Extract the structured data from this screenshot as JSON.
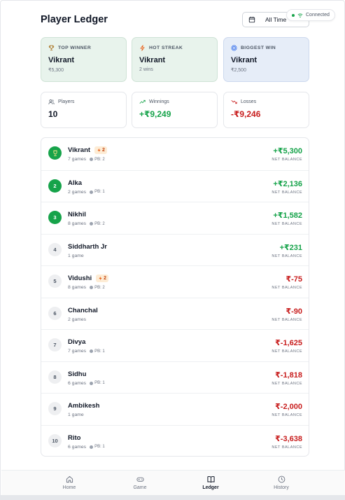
{
  "header": {
    "title": "Player Ledger",
    "range_selected": "All Time",
    "connection_status": "Connected"
  },
  "highlights": [
    {
      "label": "TOP WINNER",
      "icon": "trophy-icon",
      "name": "Vikrant",
      "sub": "₹5,300"
    },
    {
      "label": "HOT STREAK",
      "icon": "bolt-icon",
      "name": "Vikrant",
      "sub": "2 wins"
    },
    {
      "label": "BIGGEST WIN",
      "icon": "target-icon",
      "name": "Vikrant",
      "sub": "₹2,500"
    }
  ],
  "stats": [
    {
      "label": "Players",
      "icon": "users-icon",
      "value": "10"
    },
    {
      "label": "Winnings",
      "icon": "trend-up-icon",
      "value": "+₹9,249"
    },
    {
      "label": "Losses",
      "icon": "trend-down-icon",
      "value": "-₹9,246"
    }
  ],
  "balance_label": "NET BALANCE",
  "players": [
    {
      "rank": "1",
      "name": "Vikrant",
      "games": "7 games",
      "pb": "PB: 2",
      "streak": "2",
      "balance": "+₹5,300",
      "sign": "pos"
    },
    {
      "rank": "2",
      "name": "Alka",
      "games": "2 games",
      "pb": "PB: 1",
      "streak": "",
      "balance": "+₹2,136",
      "sign": "pos"
    },
    {
      "rank": "3",
      "name": "Nikhil",
      "games": "8 games",
      "pb": "PB: 2",
      "streak": "",
      "balance": "+₹1,582",
      "sign": "pos"
    },
    {
      "rank": "4",
      "name": "Siddharth Jr",
      "games": "1 game",
      "pb": "",
      "streak": "",
      "balance": "+₹231",
      "sign": "pos"
    },
    {
      "rank": "5",
      "name": "Vidushi",
      "games": "8 games",
      "pb": "PB: 2",
      "streak": "2",
      "balance": "₹-75",
      "sign": "neg"
    },
    {
      "rank": "6",
      "name": "Chanchal",
      "games": "2 games",
      "pb": "",
      "streak": "",
      "balance": "₹-90",
      "sign": "neg"
    },
    {
      "rank": "7",
      "name": "Divya",
      "games": "7 games",
      "pb": "PB: 1",
      "streak": "",
      "balance": "₹-1,625",
      "sign": "neg"
    },
    {
      "rank": "8",
      "name": "Sidhu",
      "games": "6 games",
      "pb": "PB: 1",
      "streak": "",
      "balance": "₹-1,818",
      "sign": "neg"
    },
    {
      "rank": "9",
      "name": "Ambikesh",
      "games": "1 game",
      "pb": "",
      "streak": "",
      "balance": "₹-2,000",
      "sign": "neg"
    },
    {
      "rank": "10",
      "name": "Rito",
      "games": "6 games",
      "pb": "PB: 1",
      "streak": "",
      "balance": "₹-3,638",
      "sign": "neg"
    }
  ],
  "nav": [
    {
      "label": "Home",
      "icon": "home-icon",
      "active": false
    },
    {
      "label": "Game",
      "icon": "gamepad-icon",
      "active": false
    },
    {
      "label": "Ledger",
      "icon": "book-icon",
      "active": true
    },
    {
      "label": "History",
      "icon": "clock-icon",
      "active": false
    }
  ]
}
